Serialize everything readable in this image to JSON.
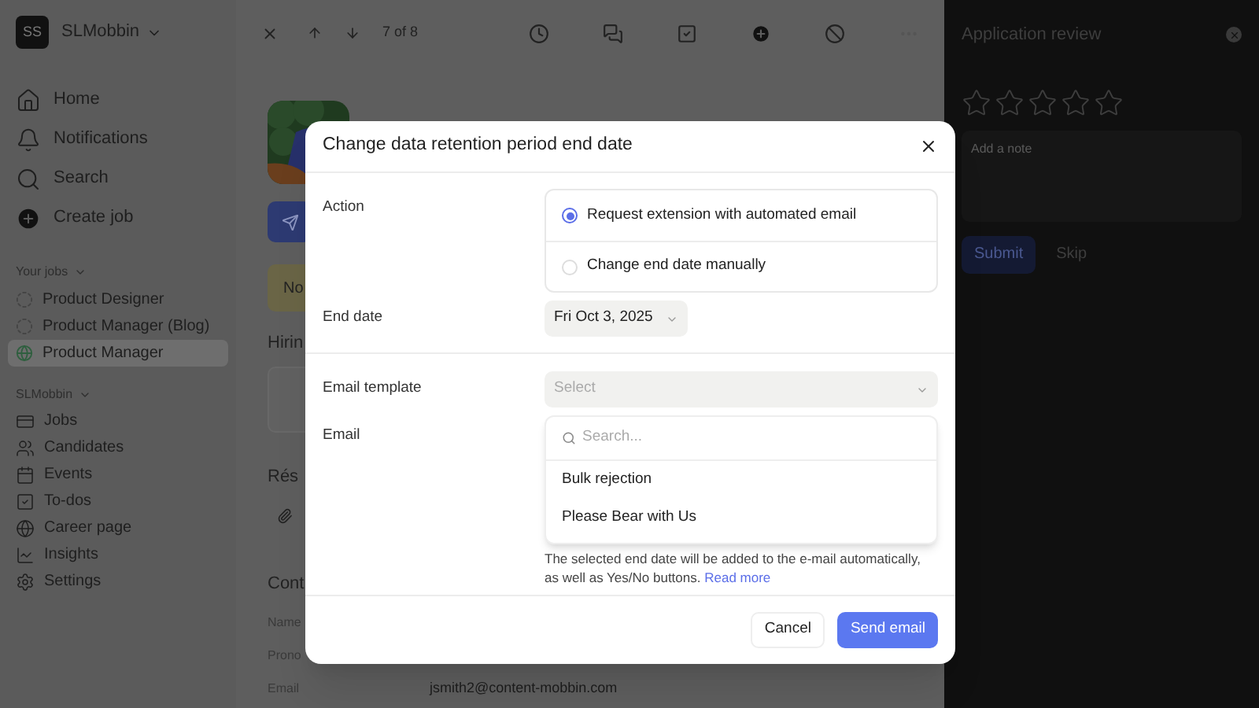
{
  "sidebar": {
    "workspace": {
      "initials": "SS",
      "name": "SLMobbin"
    },
    "nav": [
      {
        "label": "Home"
      },
      {
        "label": "Notifications"
      },
      {
        "label": "Search"
      },
      {
        "label": "Create job"
      }
    ],
    "jobs_section": {
      "heading": "Your jobs",
      "items": [
        {
          "label": "Product Designer",
          "kind": "draft",
          "selected": false
        },
        {
          "label": "Product Manager (Blog)",
          "kind": "draft",
          "selected": false
        },
        {
          "label": "Product Manager",
          "kind": "published",
          "selected": true
        }
      ]
    },
    "org_section": {
      "heading": "SLMobbin",
      "items": [
        "Jobs",
        "Candidates",
        "Events",
        "To-dos",
        "Career page",
        "Insights",
        "Settings"
      ]
    }
  },
  "top_bar": {
    "counter": "7 of 8"
  },
  "candidate": {
    "banner": "No",
    "sections": [
      "Hirin",
      "Rés",
      "Cont"
    ],
    "contact": [
      {
        "label": "Name"
      },
      {
        "label": "Prono"
      },
      {
        "label": "Email",
        "value": "jsmith2@content-mobbin.com"
      }
    ]
  },
  "review_panel": {
    "title": "Application review",
    "stars": 0,
    "note_placeholder": "Add a note",
    "buttons": [
      "Submit",
      "Skip"
    ]
  },
  "dialog": {
    "title": "Change data retention period end date",
    "action_label": "Action",
    "actions": [
      {
        "label": "Request extension with automated email",
        "selected": true
      },
      {
        "label": "Change end date manually",
        "selected": false
      }
    ],
    "end_date_label": "End date",
    "end_date": "Fri Oct 3, 2025",
    "template_label": "Email template",
    "template_placeholder": "Select",
    "email_label": "Email",
    "dropdown": {
      "search_placeholder": "Search...",
      "options": [
        "Bulk rejection",
        "Please Bear with Us"
      ]
    },
    "hint": "The selected end date will be added to the e-mail automatically, as well as Yes/No buttons.",
    "hint_link": "Read more",
    "cancel": "Cancel",
    "send": "Send email"
  }
}
